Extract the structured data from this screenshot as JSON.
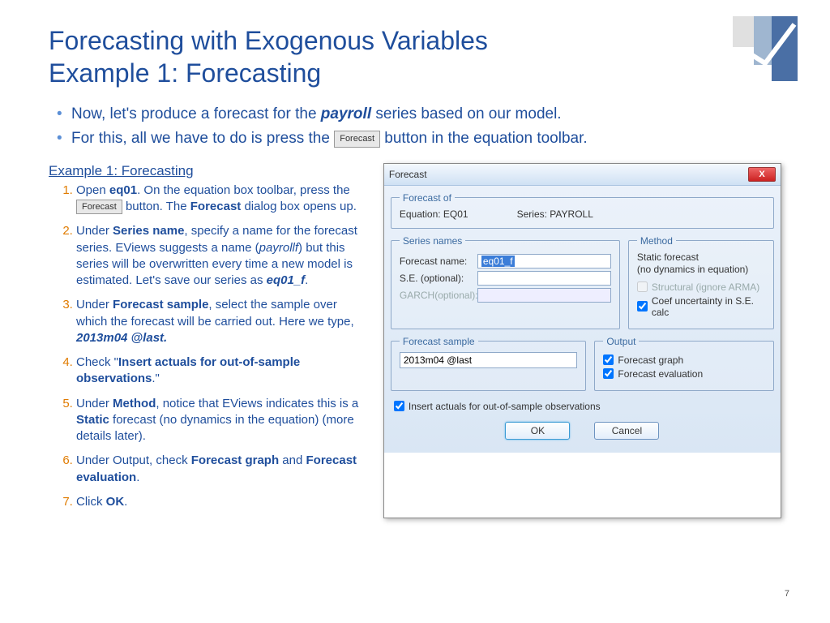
{
  "title_line1": "Forecasting with Exogenous Variables",
  "title_line2": "Example 1: Forecasting",
  "intro": {
    "line1_a": "Now, let's produce a forecast for the ",
    "line1_b": "payroll",
    "line1_c": " series based on our model.",
    "line2_a": "For this, all we have to do is press the ",
    "line2_btn": "Forecast",
    "line2_b": " button in the equation toolbar."
  },
  "example_heading": "Example 1: Forecasting",
  "steps": {
    "s1_a": "Open ",
    "s1_b": "eq01",
    "s1_c": ". On the equation box toolbar, press the ",
    "s1_btn": "Forecast",
    "s1_d": " button. The ",
    "s1_e": "Forecast",
    "s1_f": " dialog box opens up.",
    "s2_a": "Under ",
    "s2_b": "Series name",
    "s2_c": ", specify a name for the forecast series. EViews suggests a name (",
    "s2_d": "payrollf",
    "s2_e": ") but this series will be overwritten every time a new model is estimated. Let's save our series as ",
    "s2_f": "eq01_f",
    "s2_g": ".",
    "s3_a": "Under ",
    "s3_b": "Forecast sample",
    "s3_c": ", select the sample over which the forecast will be carried out. Here we type, ",
    "s3_d": "2013m04 @last.",
    "s4_a": "Check \"",
    "s4_b": "Insert actuals for out-of-sample observations",
    "s4_c": ".\"",
    "s5_a": "Under ",
    "s5_b": "Method",
    "s5_c": ", notice that EViews indicates this is a ",
    "s5_d": "Static",
    "s5_e": " forecast (no dynamics in the equation) (more details later).",
    "s6_a": "Under Output, check ",
    "s6_b": "Forecast graph",
    "s6_c": " and ",
    "s6_d": "Forecast evaluation",
    "s6_e": ".",
    "s7_a": "Click ",
    "s7_b": "OK",
    "s7_c": "."
  },
  "dialog": {
    "title": "Forecast",
    "close": "X",
    "forecast_of_legend": "Forecast of",
    "equation_label": "Equation: EQ01",
    "series_label": "Series: PAYROLL",
    "series_names_legend": "Series names",
    "forecast_name_label": "Forecast name:",
    "forecast_name_value": "eq01_f",
    "se_label": "S.E. (optional):",
    "se_value": "",
    "garch_label": "GARCH(optional):",
    "garch_value": "",
    "method_legend": "Method",
    "method_text1": "Static forecast",
    "method_text2": "(no dynamics in equation)",
    "structural_label": "Structural (ignore ARMA)",
    "coef_label": "Coef uncertainty in S.E. calc",
    "sample_legend": "Forecast sample",
    "sample_value": "2013m04 @last",
    "output_legend": "Output",
    "out_graph": "Forecast graph",
    "out_eval": "Forecast evaluation",
    "insert_actuals": "Insert actuals for out-of-sample observations",
    "ok": "OK",
    "cancel": "Cancel"
  },
  "page_number": "7"
}
